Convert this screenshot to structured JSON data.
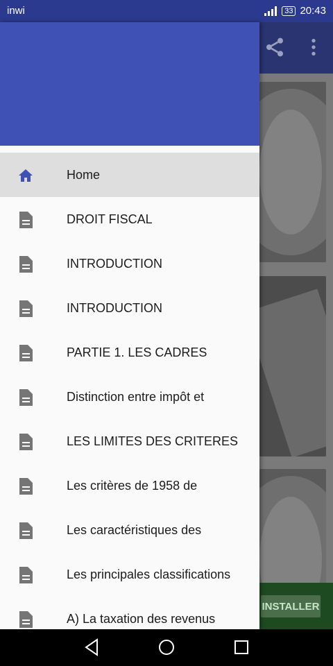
{
  "status_bar": {
    "carrier": "inwi",
    "battery": "33",
    "time": "20:43"
  },
  "toolbar": {
    "share_icon": "share-icon",
    "more_icon": "more-vert-icon"
  },
  "drawer": {
    "header_color": "#3f51b5",
    "items": [
      {
        "label": "Home",
        "icon": "home-icon",
        "active": true
      },
      {
        "label": "DROIT FISCAL",
        "icon": "document-icon"
      },
      {
        "label": "INTRODUCTION",
        "icon": "document-icon"
      },
      {
        "label": "INTRODUCTION",
        "icon": "document-icon"
      },
      {
        "label": "PARTIE 1. LES CADRES",
        "icon": "document-icon"
      },
      {
        "label": "Distinction entre impôt et",
        "icon": "document-icon"
      },
      {
        "label": "LES LIMITES DES CRITERES",
        "icon": "document-icon"
      },
      {
        "label": "Les critères de 1958 de",
        "icon": "document-icon"
      },
      {
        "label": "Les caractéristiques des",
        "icon": "document-icon"
      },
      {
        "label": "Les principales classifications",
        "icon": "document-icon"
      },
      {
        "label": "A) La taxation des revenus",
        "icon": "document-icon"
      }
    ]
  },
  "ad": {
    "install_label": "INSTALLER"
  },
  "colors": {
    "primary": "#3f51b5",
    "status_bar": "#2b3a8f",
    "active_item_bg": "#dedede"
  }
}
